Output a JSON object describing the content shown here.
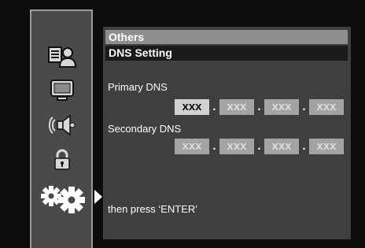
{
  "menu": {
    "items": [
      {
        "icon": "language-person-icon"
      },
      {
        "icon": "tv-screen-icon"
      },
      {
        "icon": "speaker-sound-icon"
      },
      {
        "icon": "padlock-icon"
      },
      {
        "icon": "gears-icon",
        "selected": true
      }
    ]
  },
  "breadcrumb": {
    "section": "Others",
    "page": "DNS Setting"
  },
  "primary_dns": {
    "label": "Primary DNS",
    "octets": [
      "xxx",
      "xxx",
      "xxx",
      "xxx"
    ],
    "separator": "."
  },
  "secondary_dns": {
    "label": "Secondary DNS",
    "octets": [
      "xxx",
      "xxx",
      "xxx",
      "xxx"
    ],
    "separator": "."
  },
  "hint": "then press ‘ENTER’"
}
